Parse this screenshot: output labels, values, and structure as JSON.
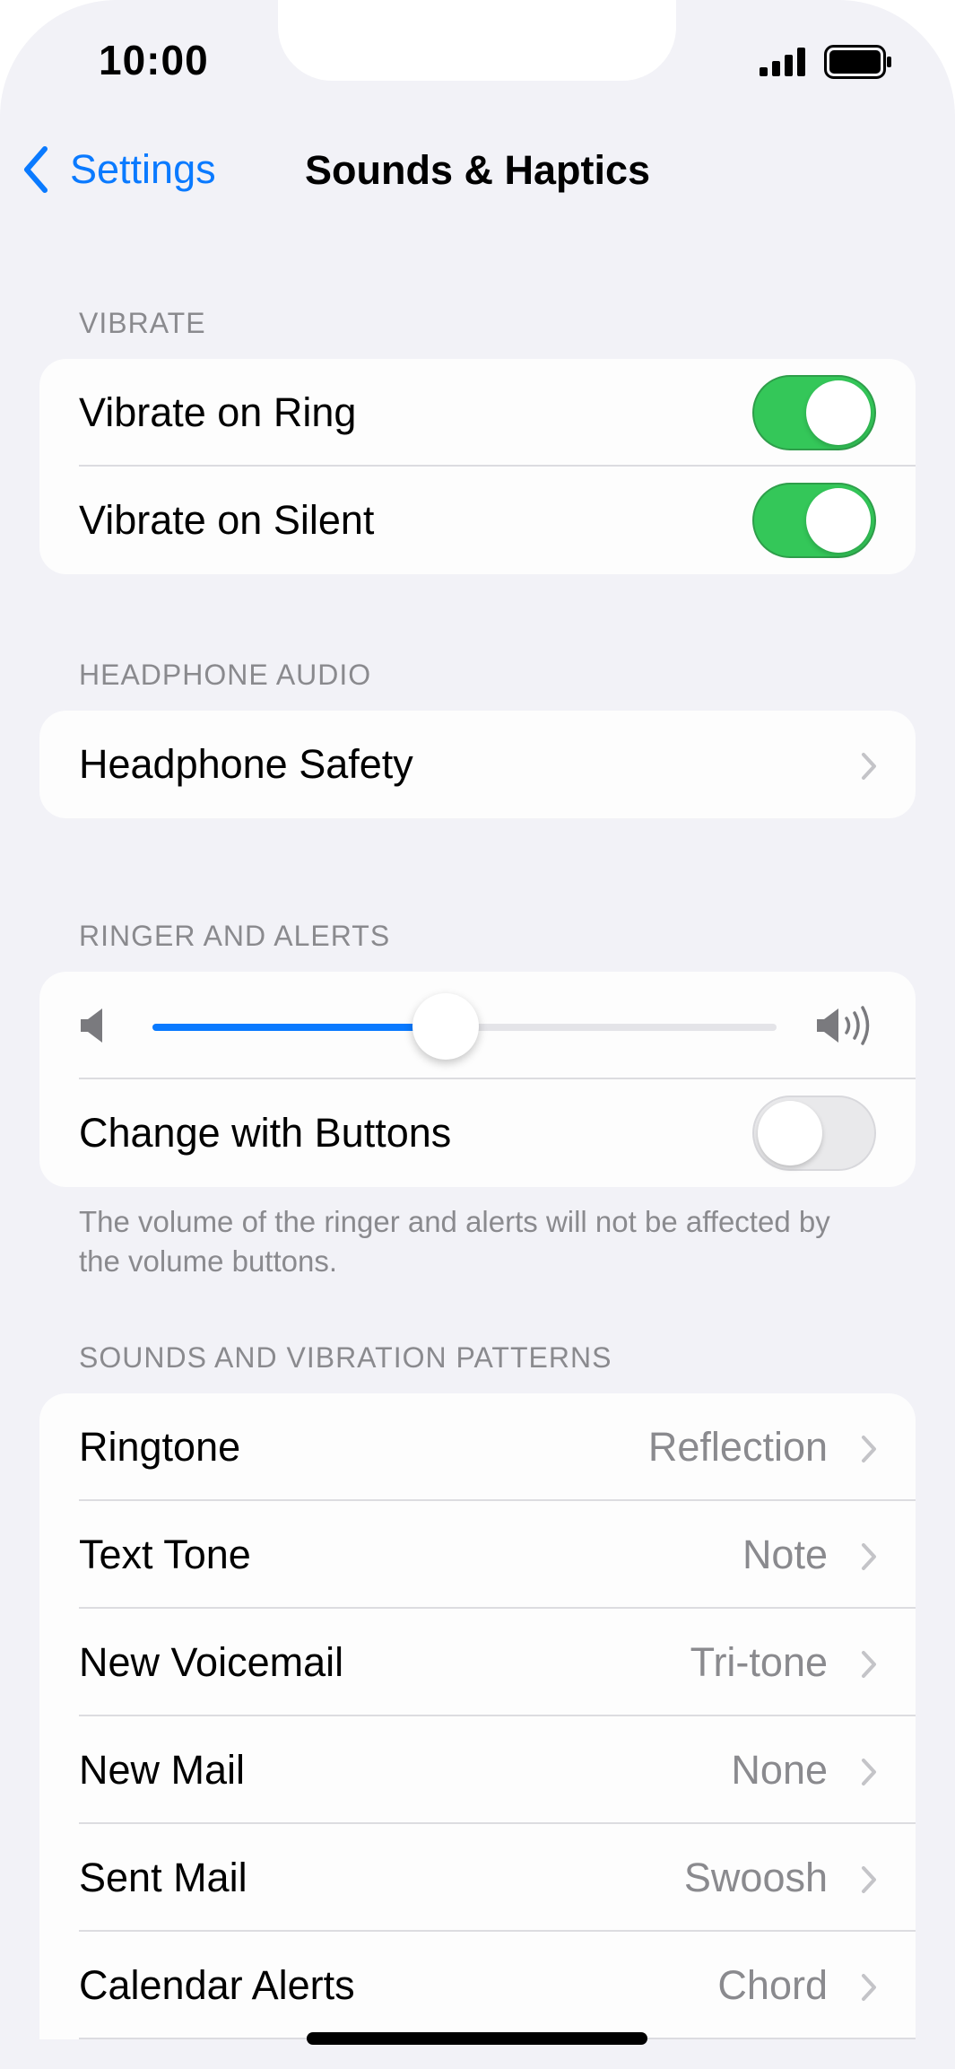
{
  "status_bar": {
    "time": "10:00"
  },
  "nav": {
    "back_label": "Settings",
    "title": "Sounds & Haptics"
  },
  "vibrate": {
    "header": "VIBRATE",
    "rows": [
      {
        "label": "Vibrate on Ring",
        "on": true
      },
      {
        "label": "Vibrate on Silent",
        "on": true
      }
    ]
  },
  "headphone_audio": {
    "header": "HEADPHONE AUDIO",
    "rows": [
      {
        "label": "Headphone Safety"
      }
    ]
  },
  "ringer": {
    "header": "RINGER AND ALERTS",
    "volume_level": 0.47,
    "change_with_buttons_label": "Change with Buttons",
    "change_with_buttons_on": false,
    "footnote": "The volume of the ringer and alerts will not be affected by the volume buttons."
  },
  "patterns": {
    "header": "SOUNDS AND VIBRATION PATTERNS",
    "rows": [
      {
        "label": "Ringtone",
        "value": "Reflection"
      },
      {
        "label": "Text Tone",
        "value": "Note"
      },
      {
        "label": "New Voicemail",
        "value": "Tri-tone"
      },
      {
        "label": "New Mail",
        "value": "None"
      },
      {
        "label": "Sent Mail",
        "value": "Swoosh"
      },
      {
        "label": "Calendar Alerts",
        "value": "Chord"
      }
    ]
  },
  "colors": {
    "accent": "#0a7aff",
    "toggle_on": "#34c759",
    "background": "#f2f2f7"
  }
}
